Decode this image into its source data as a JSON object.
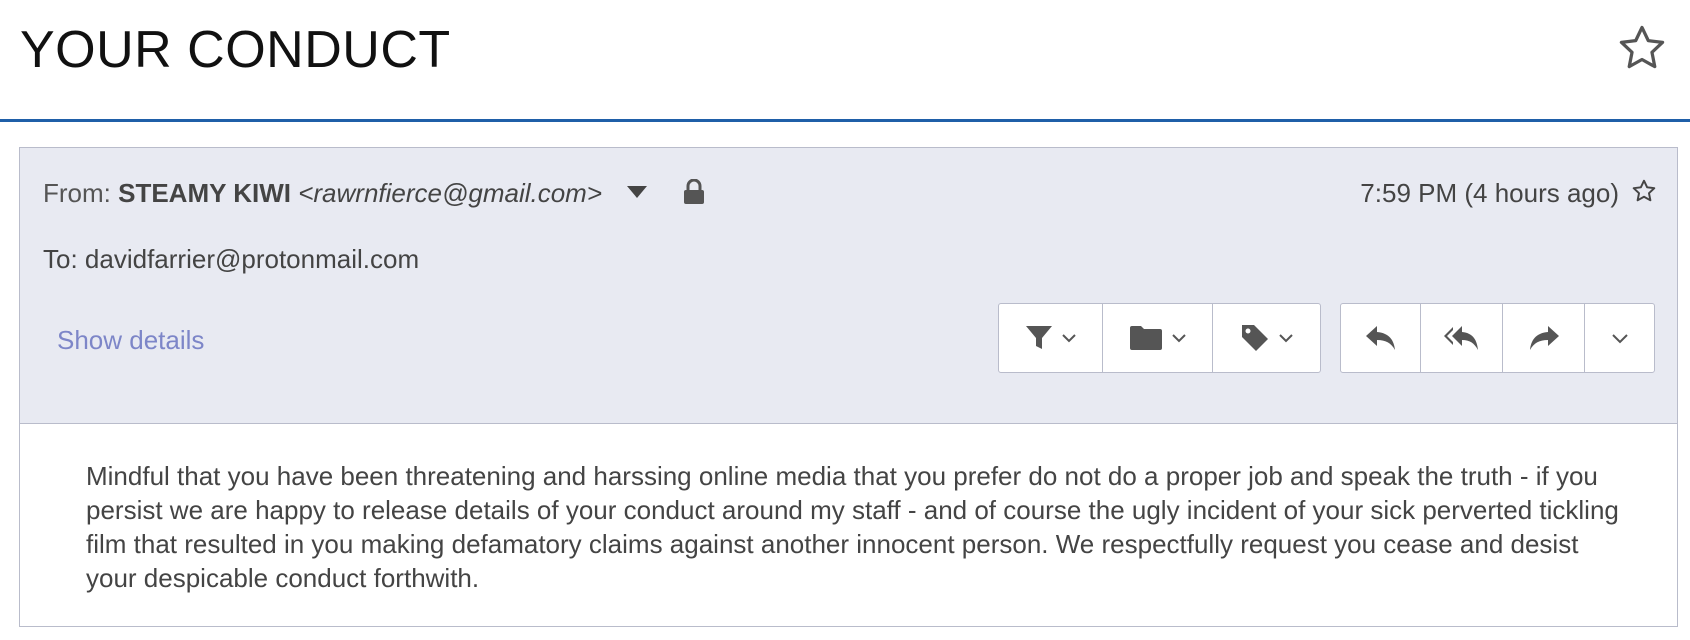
{
  "subject": {
    "title": "YOUR CONDUCT"
  },
  "header": {
    "from_label": "From: ",
    "sender_name": "STEAMY KIWI",
    "sender_email": "<rawrnfierce@gmail.com>",
    "timestamp": "7:59 PM (4 hours ago)",
    "to_label": "To: ",
    "to_address": "davidfarrier@protonmail.com",
    "show_details": "Show details"
  },
  "toolbar": {
    "left_group": [
      {
        "icon": "filter-icon"
      },
      {
        "icon": "folder-icon"
      },
      {
        "icon": "tag-icon"
      }
    ],
    "right_group": [
      {
        "icon": "reply-icon"
      },
      {
        "icon": "reply-all-icon"
      },
      {
        "icon": "forward-icon"
      },
      {
        "icon": "chevron-down-icon"
      }
    ]
  },
  "body": {
    "text": "Mindful that you have been threatening and harssing online media that you prefer do not do a proper job and speak the truth - if you persist we are happy to release details of your conduct around my staff - and of course the ugly incident of your sick perverted tickling film that resulted in you making defamatory claims against another innocent person. We respectfully request you cease and desist your despicable conduct forthwith."
  },
  "colors": {
    "accent_line": "#1f5fa8",
    "header_bg": "#e8eaf2",
    "link": "#7d86c8",
    "icon": "#555555"
  }
}
